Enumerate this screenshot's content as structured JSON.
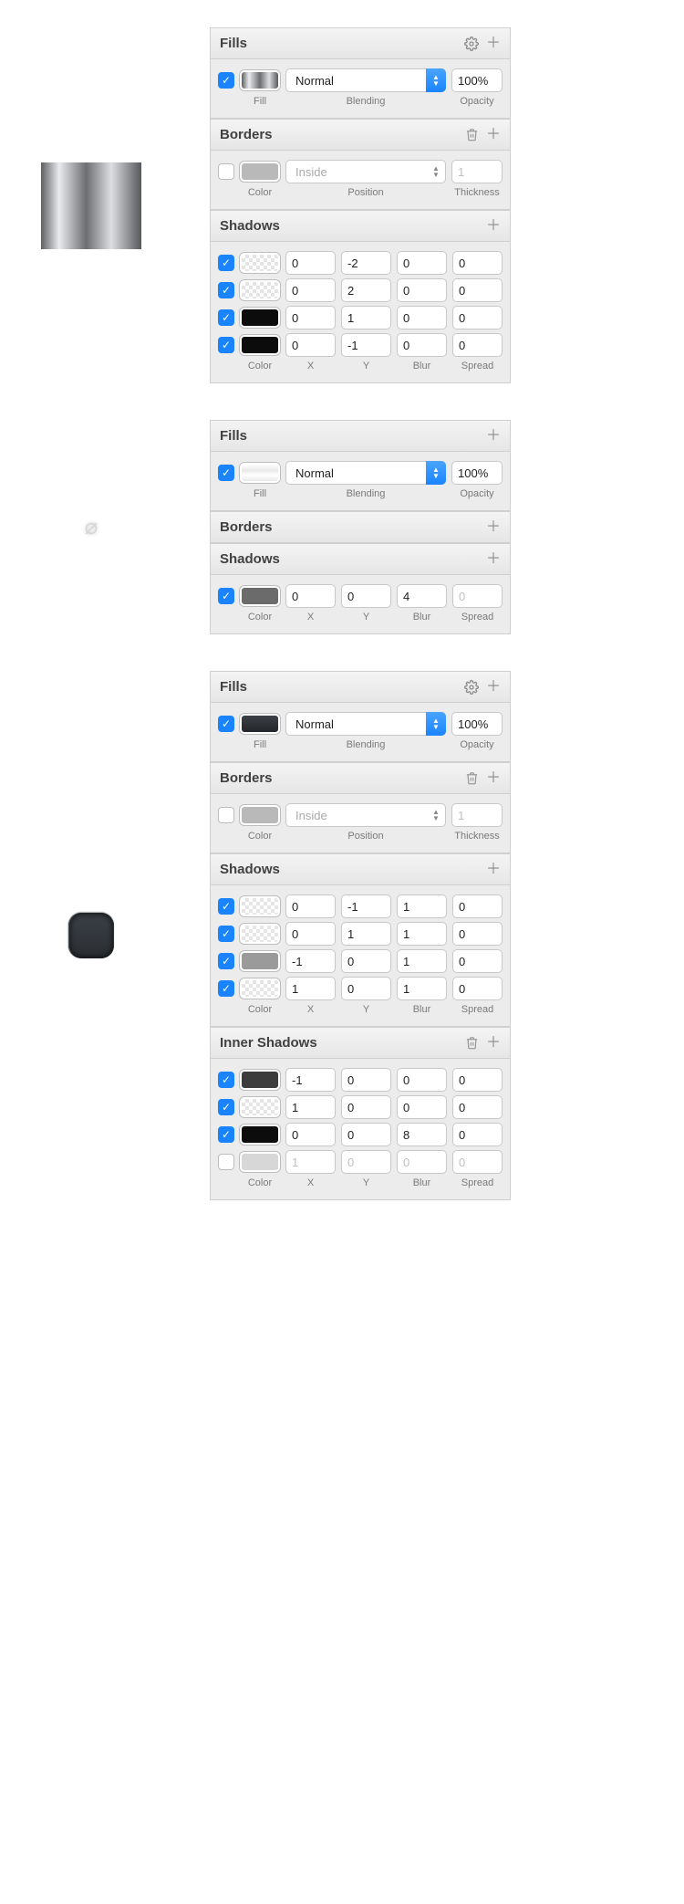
{
  "labels": {
    "fills": "Fills",
    "borders": "Borders",
    "shadows": "Shadows",
    "inner_shadows": "Inner Shadows",
    "fill": "Fill",
    "blending": "Blending",
    "opacity": "Opacity",
    "color": "Color",
    "position": "Position",
    "thickness": "Thickness",
    "x": "X",
    "y": "Y",
    "blur": "Blur",
    "spread": "Spread"
  },
  "panels": [
    {
      "fill": {
        "enabled": true,
        "swatch_css": "linear-gradient(90deg,#5d5f62 0%,#e9ebee 20%,#6c6e71 50%,#dcdee1 75%,#56585b 100%)",
        "blending": "Normal",
        "opacity": "100%"
      },
      "border": {
        "enabled": false,
        "swatch_css": "#b9b9b9",
        "position": "Inside",
        "thickness": "1"
      },
      "shadows": [
        {
          "enabled": true,
          "swatch": "transparent",
          "x": "0",
          "y": "-2",
          "blur": "0",
          "spread": "0"
        },
        {
          "enabled": true,
          "swatch": "transparent",
          "x": "0",
          "y": "2",
          "blur": "0",
          "spread": "0"
        },
        {
          "enabled": true,
          "swatch_css": "#0c0c0c",
          "x": "0",
          "y": "1",
          "blur": "0",
          "spread": "0"
        },
        {
          "enabled": true,
          "swatch_css": "#0c0c0c",
          "x": "0",
          "y": "-1",
          "blur": "0",
          "spread": "0"
        }
      ]
    },
    {
      "fill": {
        "enabled": true,
        "swatch_css": "linear-gradient(#ffffff,#e9e9e9 35%,#ffffff 65%,#e9e9e9)",
        "blending": "Normal",
        "opacity": "100%"
      },
      "shadows": [
        {
          "enabled": true,
          "swatch_css": "#6b6b6b",
          "x": "0",
          "y": "0",
          "blur": "4",
          "spread": "0",
          "spread_disabled": true
        }
      ]
    },
    {
      "fill": {
        "enabled": true,
        "swatch_css": "linear-gradient(#3d4147,#22262b)",
        "blending": "Normal",
        "opacity": "100%"
      },
      "border": {
        "enabled": false,
        "swatch_css": "#b9b9b9",
        "position": "Inside",
        "thickness": "1"
      },
      "shadows": [
        {
          "enabled": true,
          "swatch": "transparent",
          "x": "0",
          "y": "-1",
          "blur": "1",
          "spread": "0"
        },
        {
          "enabled": true,
          "swatch": "transparent",
          "x": "0",
          "y": "1",
          "blur": "1",
          "spread": "0"
        },
        {
          "enabled": true,
          "swatch_css": "#9a9a9a",
          "x": "-1",
          "y": "0",
          "blur": "1",
          "spread": "0"
        },
        {
          "enabled": true,
          "swatch": "transparent",
          "x": "1",
          "y": "0",
          "blur": "1",
          "spread": "0"
        }
      ],
      "inner_shadows": [
        {
          "enabled": true,
          "swatch_css": "#3c3c3c",
          "x": "-1",
          "y": "0",
          "blur": "0",
          "spread": "0"
        },
        {
          "enabled": true,
          "swatch": "transparent",
          "x": "1",
          "y": "0",
          "blur": "0",
          "spread": "0"
        },
        {
          "enabled": true,
          "swatch_css": "#0c0c0c",
          "x": "0",
          "y": "0",
          "blur": "8",
          "spread": "0"
        },
        {
          "enabled": false,
          "swatch_css": "#d7d7d7",
          "x": "1",
          "y": "0",
          "blur": "0",
          "spread": "0"
        }
      ]
    }
  ]
}
